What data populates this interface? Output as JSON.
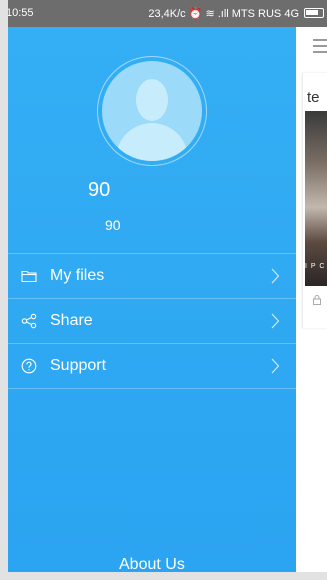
{
  "status_bar": {
    "time": "10:55",
    "right_text": "23,4K/c ⏰ ≋ .ıll MTS RUS 4G"
  },
  "background_app": {
    "card_title": "te",
    "image_caption": "I P C"
  },
  "drawer": {
    "user_name": "90",
    "user_subtitle": "90",
    "menu": [
      {
        "label": "My files",
        "icon": "folder-icon"
      },
      {
        "label": "Share",
        "icon": "share-icon"
      },
      {
        "label": "Support",
        "icon": "help-circle-icon"
      }
    ],
    "about_label": "About Us"
  },
  "colors": {
    "drawer_blue": "#2ba4f1",
    "status_bar": "#6d6d6d"
  }
}
